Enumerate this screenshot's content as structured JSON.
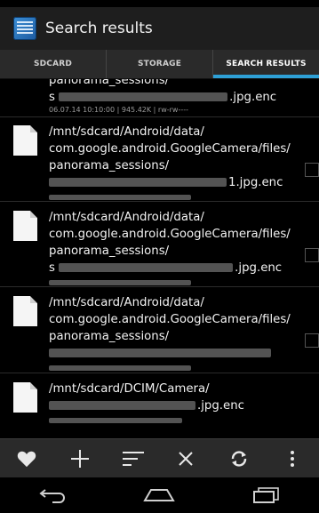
{
  "header": {
    "title": "Search results"
  },
  "tabs": [
    {
      "label": "SDCARD"
    },
    {
      "label": "STORAGE"
    },
    {
      "label": "SEARCH RESULTS"
    }
  ],
  "results": [
    {
      "lines": [
        "panorama_sessions/"
      ],
      "obscured_prefix": "s",
      "filename_tail": ".jpg.enc",
      "meta": "06.07.14 10:10:00 | 945.42K | rw-rw----"
    },
    {
      "lines": [
        "/mnt/sdcard/Android/data/",
        "com.google.android.GoogleCamera/files/",
        "panorama_sessions/"
      ],
      "obscured_prefix": "",
      "filename_tail": "1.jpg.enc"
    },
    {
      "lines": [
        "/mnt/sdcard/Android/data/",
        "com.google.android.GoogleCamera/files/",
        "panorama_sessions/"
      ],
      "obscured_prefix": "s",
      "filename_tail": ".jpg.enc"
    },
    {
      "lines": [
        "/mnt/sdcard/Android/data/",
        "com.google.android.GoogleCamera/files/",
        "panorama_sessions/"
      ],
      "obscured_prefix": "",
      "filename_tail": ""
    },
    {
      "lines": [
        "/mnt/sdcard/DCIM/Camera/"
      ],
      "obscured_prefix": "",
      "filename_tail": ".jpg.enc"
    }
  ],
  "toolbar": {
    "buttons": [
      {
        "icon": "heart-icon"
      },
      {
        "icon": "plus-icon"
      },
      {
        "icon": "sort-icon"
      },
      {
        "icon": "close-icon"
      },
      {
        "icon": "refresh-icon"
      },
      {
        "icon": "overflow-menu-icon"
      }
    ]
  },
  "navigation": {
    "buttons": [
      {
        "icon": "back-icon"
      },
      {
        "icon": "home-icon"
      },
      {
        "icon": "recents-icon"
      }
    ]
  },
  "colors": {
    "accent": "#2ea0d6",
    "background": "#000000",
    "bar": "#2a2a2a"
  }
}
